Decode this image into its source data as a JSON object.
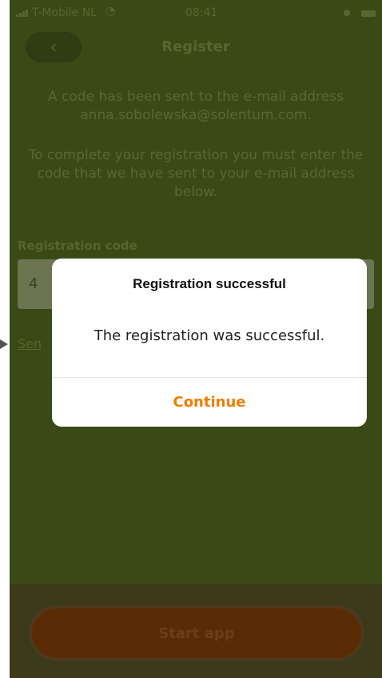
{
  "status_bar": {
    "carrier": "T-Mobile NL",
    "time": "08:41"
  },
  "header": {
    "back_icon": "chevron-left-icon",
    "title": "Register"
  },
  "main": {
    "paragraph1": "A code has been sent to the e-mail address anna.sobolewska@solentum.com.",
    "paragraph2": "To complete your registration you must enter the code that we have sent to your e-mail address below.",
    "code_label": "Registration code",
    "code_value": "4",
    "resend_link": "Sen"
  },
  "footer": {
    "start_label": "Start app"
  },
  "dialog": {
    "title": "Registration successful",
    "message": "The registration was successful.",
    "button": "Continue",
    "button_color": "#f07d00"
  },
  "colors": {
    "overlay_background": "#3a4a17",
    "start_button": "#5a2c06"
  }
}
